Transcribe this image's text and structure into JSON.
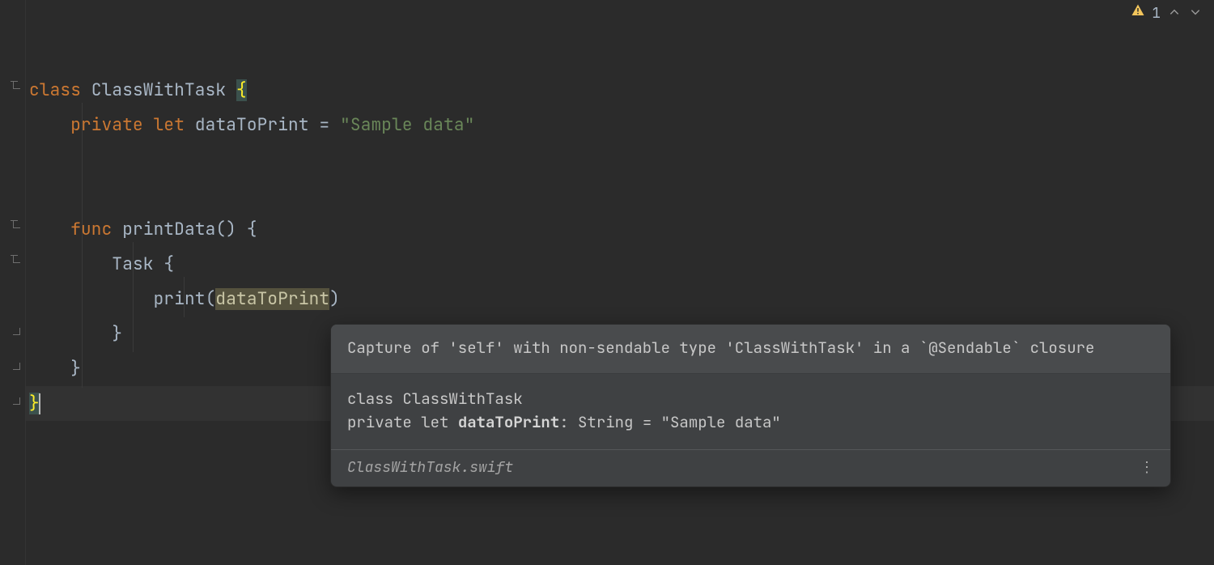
{
  "inspection": {
    "warning_count": "1"
  },
  "code": {
    "line1": {
      "kw": "class",
      "name": "ClassWithTask",
      "brace": "{"
    },
    "line2": {
      "kw1": "private",
      "kw2": "let",
      "name": "dataToPrint",
      "eq": "=",
      "str": "\"Sample data\""
    },
    "line4": {
      "kw": "func",
      "name": "printData",
      "parens": "()",
      "brace": "{"
    },
    "line5": {
      "name": "Task",
      "brace": "{"
    },
    "line6": {
      "call": "print",
      "lp": "(",
      "arg": "dataToPrint",
      "rp": ")"
    },
    "line7": {
      "brace": "}"
    },
    "line8": {
      "brace": "}"
    },
    "line9": {
      "brace": "}"
    }
  },
  "tooltip": {
    "warning": "Capture of 'self' with non-sendable type 'ClassWithTask' in a `@Sendable` closure",
    "decl_class_kw": "class",
    "decl_class_name": "ClassWithTask",
    "decl_prop_mods": "private let",
    "decl_prop_name": "dataToPrint",
    "decl_prop_sig": ": String = \"Sample data\"",
    "file": "ClassWithTask.swift"
  }
}
